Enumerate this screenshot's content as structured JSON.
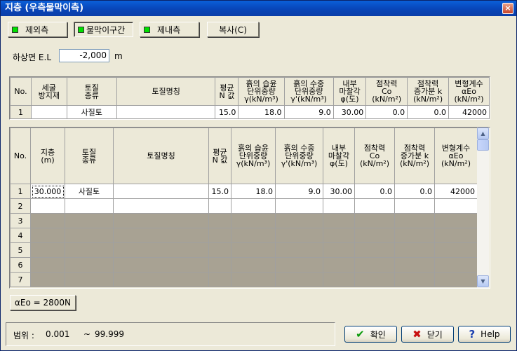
{
  "window": {
    "title": "지층 (우측물막이측)",
    "close": "×"
  },
  "toolbar": {
    "toggles": [
      {
        "label": "제외측"
      },
      {
        "label": "물막이구간"
      },
      {
        "label": "제내측"
      }
    ],
    "copy_label": "복사(C)"
  },
  "elevation": {
    "label": "하상면 E.L",
    "value": "-2,000",
    "unit": "m"
  },
  "top_table": {
    "headers": [
      "No.",
      "세굴\n방지재",
      "토질\n종류",
      "토질명칭",
      "평균\nN 값",
      "흙의 습윤\n단위중량\nγ(kN/m³)",
      "흙의 수중\n단위중량\nγ'(kN/m³)",
      "내부\n마찰각\nφ(도)",
      "점착력\nCo\n(kN/m²)",
      "점착력\n증가분 k\n(kN/m²)",
      "변형계수\nαEo\n(kN/m²)"
    ],
    "rows": [
      [
        "1",
        "",
        "사질토",
        "",
        "15.0",
        "18.0",
        "9.0",
        "30.00",
        "0.0",
        "0.0",
        "42000"
      ]
    ]
  },
  "main_table": {
    "headers": [
      "No.",
      "지층\n(m)",
      "토질\n종류",
      "토질명칭",
      "평균\nN 값",
      "흙의 습윤\n단위중량\nγ(kN/m³)",
      "흙의 수중\n단위중량\nγ'(kN/m³)",
      "내부\n마찰각\nφ(도)",
      "점착력\nCo\n(kN/m²)",
      "점착력\n증가분 k\n(kN/m²)",
      "변형계수\nαEo\n(kN/m²)"
    ],
    "rows": [
      [
        "1",
        "30.000",
        "사질토",
        "",
        "15.0",
        "18.0",
        "9.0",
        "30.00",
        "0.0",
        "0.0",
        "42000"
      ],
      [
        "2",
        "",
        "",
        "",
        "",
        "",
        "",
        "",
        "",
        "",
        ""
      ],
      [
        "3",
        "",
        "",
        "",
        "",
        "",
        "",
        "",
        "",
        "",
        ""
      ],
      [
        "4",
        "",
        "",
        "",
        "",
        "",
        "",
        "",
        "",
        "",
        ""
      ],
      [
        "5",
        "",
        "",
        "",
        "",
        "",
        "",
        "",
        "",
        "",
        ""
      ],
      [
        "6",
        "",
        "",
        "",
        "",
        "",
        "",
        "",
        "",
        "",
        ""
      ],
      [
        "7",
        "",
        "",
        "",
        "",
        "",
        "",
        "",
        "",
        "",
        ""
      ]
    ]
  },
  "aeo_button": "αEo = 2800N",
  "status": {
    "range_label": "범위 :",
    "range_min": "0.001",
    "range_sep": "~",
    "range_max": "99.999"
  },
  "buttons": {
    "ok": "확인",
    "cancel": "닫기",
    "help": "Help"
  },
  "icons": {
    "ok": "check-icon",
    "cancel": "x-icon",
    "help": "question-icon"
  },
  "colors": {
    "title_bar": "#0845b8",
    "empty_row": "#a8a293",
    "led": "#00e000"
  }
}
